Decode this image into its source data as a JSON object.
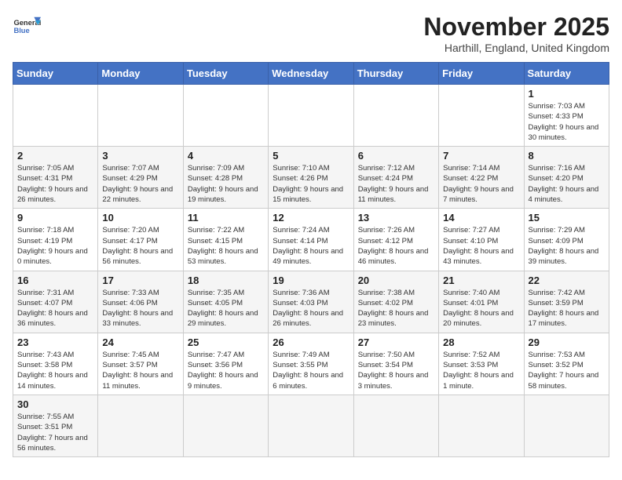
{
  "header": {
    "logo_text_normal": "General",
    "logo_text_bold": "Blue",
    "title": "November 2025",
    "subtitle": "Harthill, England, United Kingdom"
  },
  "weekdays": [
    "Sunday",
    "Monday",
    "Tuesday",
    "Wednesday",
    "Thursday",
    "Friday",
    "Saturday"
  ],
  "weeks": [
    [
      {
        "day": "",
        "info": ""
      },
      {
        "day": "",
        "info": ""
      },
      {
        "day": "",
        "info": ""
      },
      {
        "day": "",
        "info": ""
      },
      {
        "day": "",
        "info": ""
      },
      {
        "day": "",
        "info": ""
      },
      {
        "day": "1",
        "info": "Sunrise: 7:03 AM\nSunset: 4:33 PM\nDaylight: 9 hours and 30 minutes."
      }
    ],
    [
      {
        "day": "2",
        "info": "Sunrise: 7:05 AM\nSunset: 4:31 PM\nDaylight: 9 hours and 26 minutes."
      },
      {
        "day": "3",
        "info": "Sunrise: 7:07 AM\nSunset: 4:29 PM\nDaylight: 9 hours and 22 minutes."
      },
      {
        "day": "4",
        "info": "Sunrise: 7:09 AM\nSunset: 4:28 PM\nDaylight: 9 hours and 19 minutes."
      },
      {
        "day": "5",
        "info": "Sunrise: 7:10 AM\nSunset: 4:26 PM\nDaylight: 9 hours and 15 minutes."
      },
      {
        "day": "6",
        "info": "Sunrise: 7:12 AM\nSunset: 4:24 PM\nDaylight: 9 hours and 11 minutes."
      },
      {
        "day": "7",
        "info": "Sunrise: 7:14 AM\nSunset: 4:22 PM\nDaylight: 9 hours and 7 minutes."
      },
      {
        "day": "8",
        "info": "Sunrise: 7:16 AM\nSunset: 4:20 PM\nDaylight: 9 hours and 4 minutes."
      }
    ],
    [
      {
        "day": "9",
        "info": "Sunrise: 7:18 AM\nSunset: 4:19 PM\nDaylight: 9 hours and 0 minutes."
      },
      {
        "day": "10",
        "info": "Sunrise: 7:20 AM\nSunset: 4:17 PM\nDaylight: 8 hours and 56 minutes."
      },
      {
        "day": "11",
        "info": "Sunrise: 7:22 AM\nSunset: 4:15 PM\nDaylight: 8 hours and 53 minutes."
      },
      {
        "day": "12",
        "info": "Sunrise: 7:24 AM\nSunset: 4:14 PM\nDaylight: 8 hours and 49 minutes."
      },
      {
        "day": "13",
        "info": "Sunrise: 7:26 AM\nSunset: 4:12 PM\nDaylight: 8 hours and 46 minutes."
      },
      {
        "day": "14",
        "info": "Sunrise: 7:27 AM\nSunset: 4:10 PM\nDaylight: 8 hours and 43 minutes."
      },
      {
        "day": "15",
        "info": "Sunrise: 7:29 AM\nSunset: 4:09 PM\nDaylight: 8 hours and 39 minutes."
      }
    ],
    [
      {
        "day": "16",
        "info": "Sunrise: 7:31 AM\nSunset: 4:07 PM\nDaylight: 8 hours and 36 minutes."
      },
      {
        "day": "17",
        "info": "Sunrise: 7:33 AM\nSunset: 4:06 PM\nDaylight: 8 hours and 33 minutes."
      },
      {
        "day": "18",
        "info": "Sunrise: 7:35 AM\nSunset: 4:05 PM\nDaylight: 8 hours and 29 minutes."
      },
      {
        "day": "19",
        "info": "Sunrise: 7:36 AM\nSunset: 4:03 PM\nDaylight: 8 hours and 26 minutes."
      },
      {
        "day": "20",
        "info": "Sunrise: 7:38 AM\nSunset: 4:02 PM\nDaylight: 8 hours and 23 minutes."
      },
      {
        "day": "21",
        "info": "Sunrise: 7:40 AM\nSunset: 4:01 PM\nDaylight: 8 hours and 20 minutes."
      },
      {
        "day": "22",
        "info": "Sunrise: 7:42 AM\nSunset: 3:59 PM\nDaylight: 8 hours and 17 minutes."
      }
    ],
    [
      {
        "day": "23",
        "info": "Sunrise: 7:43 AM\nSunset: 3:58 PM\nDaylight: 8 hours and 14 minutes."
      },
      {
        "day": "24",
        "info": "Sunrise: 7:45 AM\nSunset: 3:57 PM\nDaylight: 8 hours and 11 minutes."
      },
      {
        "day": "25",
        "info": "Sunrise: 7:47 AM\nSunset: 3:56 PM\nDaylight: 8 hours and 9 minutes."
      },
      {
        "day": "26",
        "info": "Sunrise: 7:49 AM\nSunset: 3:55 PM\nDaylight: 8 hours and 6 minutes."
      },
      {
        "day": "27",
        "info": "Sunrise: 7:50 AM\nSunset: 3:54 PM\nDaylight: 8 hours and 3 minutes."
      },
      {
        "day": "28",
        "info": "Sunrise: 7:52 AM\nSunset: 3:53 PM\nDaylight: 8 hours and 1 minute."
      },
      {
        "day": "29",
        "info": "Sunrise: 7:53 AM\nSunset: 3:52 PM\nDaylight: 7 hours and 58 minutes."
      }
    ],
    [
      {
        "day": "30",
        "info": "Sunrise: 7:55 AM\nSunset: 3:51 PM\nDaylight: 7 hours and 56 minutes."
      },
      {
        "day": "",
        "info": ""
      },
      {
        "day": "",
        "info": ""
      },
      {
        "day": "",
        "info": ""
      },
      {
        "day": "",
        "info": ""
      },
      {
        "day": "",
        "info": ""
      },
      {
        "day": "",
        "info": ""
      }
    ]
  ]
}
